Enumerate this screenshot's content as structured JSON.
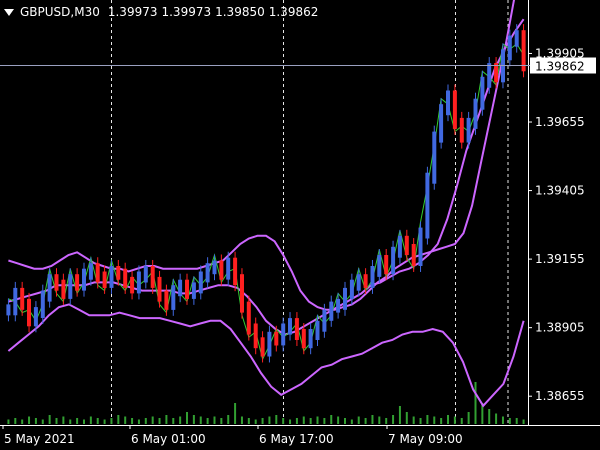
{
  "chart_header": {
    "symbol": "GBPUSD,M30",
    "open": "1.39973",
    "high": "1.39973",
    "low": "1.39850",
    "close": "1.39862"
  },
  "current_price": "1.39862",
  "colors": {
    "background": "#000000",
    "bull_candle": "#4169e1",
    "bear_candle": "#ff2020",
    "heiken_bull": "#4169e1",
    "envelope_bands": "#cc66ff",
    "price_line": "#32cd32",
    "volume": "#32a032",
    "grid": "#ffffff",
    "price_marker": "#9aa0c0"
  },
  "chart_data": {
    "type": "line",
    "instrument": "GBPUSD",
    "timeframe": "M30",
    "y_tick_labels": [
      "1.39905",
      "1.39655",
      "1.39405",
      "1.39155",
      "1.38905",
      "1.38655"
    ],
    "ylim": [
      1.3855,
      1.401
    ],
    "x_tick_labels": [
      "5 May 2021",
      "6 May 01:00",
      "6 May 17:00",
      "7 May 09:00"
    ],
    "grid": "vertical dotted",
    "n_bars": 76,
    "series": [
      {
        "key": "close",
        "values": [
          1.3897,
          1.3903,
          1.3899,
          1.3893,
          1.3896,
          1.3902,
          1.3908,
          1.3906,
          1.3903,
          1.3908,
          1.3906,
          1.391,
          1.3912,
          1.3909,
          1.3907,
          1.3911,
          1.391,
          1.3907,
          1.3905,
          1.3909,
          1.3911,
          1.3907,
          1.3902,
          1.3899,
          1.3904,
          1.3906,
          1.3903,
          1.3905,
          1.3909,
          1.3912,
          1.3913,
          1.391,
          1.3914,
          1.3908,
          1.3898,
          1.389,
          1.3885,
          1.3882,
          1.3887,
          1.3886,
          1.389,
          1.3892,
          1.3888,
          1.3885,
          1.3888,
          1.3891,
          1.3895,
          1.3898,
          1.3899,
          1.3903,
          1.3906,
          1.3908,
          1.3907,
          1.3911,
          1.3915,
          1.3912,
          1.3918,
          1.3922,
          1.3919,
          1.3915,
          1.3925,
          1.3945,
          1.396,
          1.397,
          1.3975,
          1.3965,
          1.396,
          1.3965,
          1.3972,
          1.398,
          1.3985,
          1.3982,
          1.399,
          1.3995,
          1.3997,
          1.3986
        ]
      },
      {
        "key": "upper_band",
        "values": [
          1.3915,
          1.3914,
          1.3913,
          1.3912,
          1.3912,
          1.3913,
          1.3915,
          1.3917,
          1.3918,
          1.3916,
          1.3914,
          1.3913,
          1.3912,
          1.3912,
          1.3911,
          1.3912,
          1.3913,
          1.3913,
          1.3912,
          1.3912,
          1.3912,
          1.3912,
          1.3912,
          1.3913,
          1.3914,
          1.3915,
          1.3918,
          1.3921,
          1.3923,
          1.3924,
          1.3924,
          1.3922,
          1.3917,
          1.3911,
          1.3904,
          1.39,
          1.3898,
          1.3897,
          1.3897,
          1.3898,
          1.3899,
          1.3901,
          1.3904,
          1.3907,
          1.3909,
          1.3912,
          1.3914,
          1.3916,
          1.3917,
          1.3918,
          1.3919,
          1.392,
          1.3921,
          1.3925,
          1.3935,
          1.395,
          1.3965,
          1.398,
          1.3995,
          1.4012,
          1.4025
        ]
      },
      {
        "key": "middle_band",
        "values": [
          1.39,
          1.3901,
          1.3902,
          1.3903,
          1.3904,
          1.3906,
          1.3906,
          1.3906,
          1.3906,
          1.3907,
          1.3907,
          1.3907,
          1.3906,
          1.3905,
          1.3904,
          1.3904,
          1.3904,
          1.3904,
          1.3903,
          1.3903,
          1.3904,
          1.3905,
          1.3906,
          1.3906,
          1.3905,
          1.3902,
          1.3898,
          1.3893,
          1.389,
          1.3888,
          1.3889,
          1.3891,
          1.3893,
          1.3895,
          1.3897,
          1.3899,
          1.3901,
          1.3903,
          1.3906,
          1.3907,
          1.3909,
          1.3911,
          1.3912,
          1.3914,
          1.3917,
          1.3921,
          1.393,
          1.3942,
          1.3955,
          1.3965,
          1.3975,
          1.3985,
          1.3992,
          1.3998,
          1.4003
        ]
      },
      {
        "key": "lower_band",
        "values": [
          1.3882,
          1.3885,
          1.3888,
          1.3891,
          1.3895,
          1.3898,
          1.3899,
          1.3897,
          1.3895,
          1.3895,
          1.3895,
          1.3896,
          1.3895,
          1.3894,
          1.3894,
          1.3894,
          1.3893,
          1.3892,
          1.3891,
          1.3892,
          1.3893,
          1.3893,
          1.389,
          1.3885,
          1.388,
          1.3874,
          1.3869,
          1.3866,
          1.3868,
          1.387,
          1.3873,
          1.3876,
          1.3877,
          1.3879,
          1.388,
          1.3881,
          1.3883,
          1.3885,
          1.3886,
          1.3888,
          1.3889,
          1.3889,
          1.389,
          1.3889,
          1.3885,
          1.3878,
          1.3868,
          1.3862,
          1.3866,
          1.387,
          1.388,
          1.3893
        ]
      },
      {
        "key": "volume",
        "values": [
          3,
          4,
          3,
          5,
          4,
          3,
          6,
          4,
          5,
          3,
          4,
          3,
          5,
          4,
          3,
          4,
          6,
          5,
          4,
          3,
          4,
          5,
          4,
          6,
          4,
          5,
          8,
          6,
          5,
          4,
          5,
          4,
          6,
          14,
          5,
          4,
          3,
          4,
          5,
          6,
          4,
          3,
          4,
          5,
          4,
          5,
          4,
          6,
          5,
          4,
          3,
          5,
          4,
          6,
          5,
          4,
          6,
          12,
          8,
          5,
          4,
          6,
          5,
          4,
          6,
          5,
          4,
          8,
          28,
          14,
          10,
          7,
          5,
          4,
          4,
          3
        ]
      }
    ]
  }
}
